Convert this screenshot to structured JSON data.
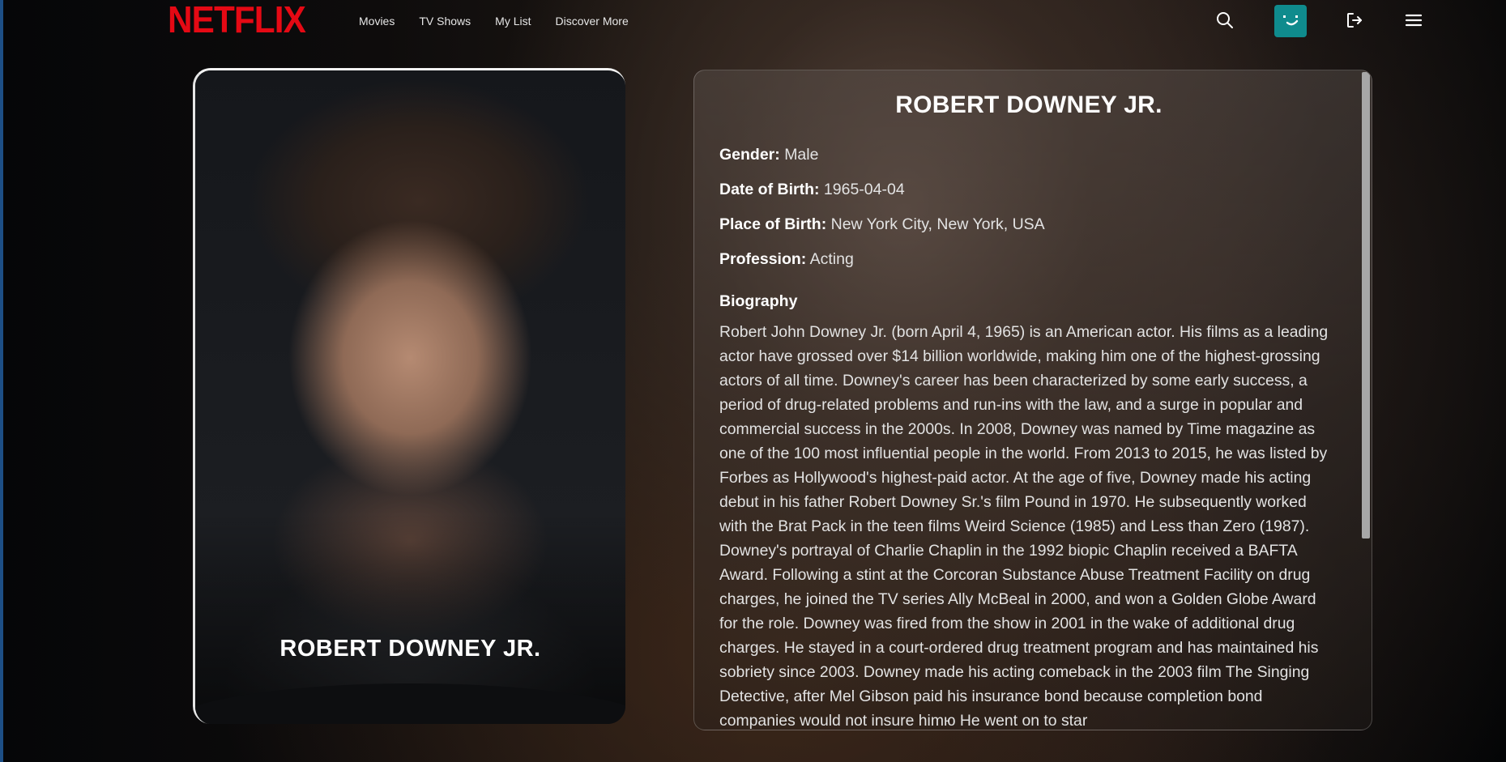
{
  "header": {
    "logo": "NETFLIX",
    "nav": [
      "Movies",
      "TV Shows",
      "My List",
      "Discover More"
    ],
    "icons": [
      "search-icon",
      "avatar",
      "logout-icon",
      "menu-icon"
    ],
    "accent_color": "#e50914",
    "avatar_color": "#0f8b8d"
  },
  "card": {
    "name": "ROBERT DOWNEY JR."
  },
  "info": {
    "title": "ROBERT DOWNEY JR.",
    "gender_label": "Gender:",
    "gender": "Male",
    "dob_label": "Date of Birth:",
    "dob": "1965-04-04",
    "pob_label": "Place of Birth:",
    "pob": "New York City, New York, USA",
    "profession_label": "Profession:",
    "profession": "Acting",
    "bio_heading": "Biography",
    "bio": "Robert John Downey Jr. (born April 4, 1965) is an American actor. His films as a leading actor have grossed over $14 billion worldwide, making him one of the highest-grossing actors of all time. Downey's career has been characterized by some early success, a period of drug-related problems and run-ins with the law, and a surge in popular and commercial success in the 2000s. In 2008, Downey was named by Time magazine as one of the 100 most influential people in the world. From 2013 to 2015, he was listed by Forbes as Hollywood's highest-paid actor. At the age of five, Downey made his acting debut in his father Robert Downey Sr.'s film Pound in 1970. He subsequently worked with the Brat Pack in the teen films Weird Science (1985) and Less than Zero (1987). Downey's portrayal of Charlie Chaplin in the 1992 biopic Chaplin received a BAFTA Award. Following a stint at the Corcoran Substance Abuse Treatment Facility on drug charges, he joined the TV series Ally McBeal in 2000, and won a Golden Globe Award for the role. Downey was fired from the show in 2001 in the wake of additional drug charges. He stayed in a court-ordered drug treatment program and has maintained his sobriety since 2003. Downey made his acting comeback in the 2003 film The Singing Detective, after Mel Gibson paid his insurance bond because completion bond companies would not insure himю He went on to star"
  }
}
